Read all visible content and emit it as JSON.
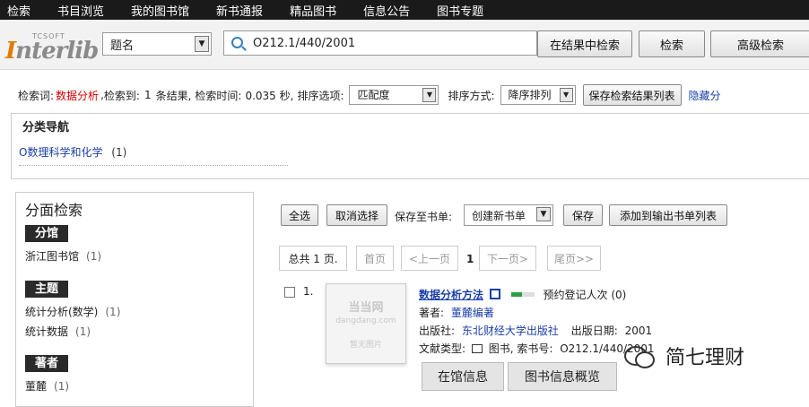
{
  "topnav": [
    "检索",
    "书目浏览",
    "我的图书馆",
    "新书通报",
    "精品图书",
    "信息公告",
    "图书专题"
  ],
  "logo": {
    "tcsoft": "TCSOFT",
    "interlib_i": "I",
    "interlib_rest": "nterlib"
  },
  "search": {
    "field": "题名",
    "query": "O212.1/440/2001",
    "btn_within": "在结果中检索",
    "btn_search": "检索",
    "btn_advanced": "高级检索"
  },
  "info": {
    "label_query": "检索词:",
    "query": "数据分析",
    "label_found": "检索到:",
    "count": "1",
    "label_results": "条结果,",
    "label_time": "检索时间:",
    "time": "0.035 秒,",
    "label_sort": "排序选项:",
    "sort_option": "匹配度",
    "label_order": "排序方式:",
    "sort_order": "降序排列",
    "btn_save": "保存检索结果列表",
    "link_hide": "隐藏分"
  },
  "category": {
    "title": "分类导航",
    "link": "O数理科学和化学",
    "count": "(1)"
  },
  "facets": {
    "title": "分面检索",
    "groups": [
      {
        "head": "分馆",
        "items": [
          {
            "label": "浙江图书馆",
            "count": "(1)"
          }
        ]
      },
      {
        "head": "主题",
        "items": [
          {
            "label": "统计分析(数学)",
            "count": "(1)"
          },
          {
            "label": "统计数据",
            "count": "(1)"
          }
        ]
      },
      {
        "head": "著者",
        "items": [
          {
            "label": "董麓",
            "count": "(1)"
          }
        ]
      }
    ]
  },
  "toolbar": {
    "select_all": "全选",
    "cancel": "取消选择",
    "save_to_label": "保存至书单:",
    "booklist": "创建新书单",
    "save": "保存",
    "add_to_output": "添加到输出书单列表"
  },
  "pager": {
    "total": "总共 1 页.",
    "first": "首页",
    "prev": "<上一页",
    "current": "1",
    "next": "下一页>",
    "last": "尾页>>"
  },
  "result": {
    "index": "1.",
    "title": "数据分析方法",
    "reserve_text": "预约登记人次 (0)",
    "author_label": "著者:",
    "author": "董麓编著",
    "publisher_label": "出版社:",
    "publisher": "东北财经大学出版社",
    "date_label": "出版日期:",
    "date": "2001",
    "type_label": "文献类型:",
    "type": "图书, 索书号:",
    "callno": "O212.1/440/2001",
    "thumb_line1": "当当网",
    "thumb_line2": "dangdang.com",
    "thumb_line3": "暂无图片",
    "tab_holdings": "在馆信息",
    "tab_overview": "图书信息概览"
  },
  "watermark": "简七理财",
  "colors": {
    "accent_red": "#d40000",
    "link_blue": "#1a3fa8",
    "nav_bg": "#1a1a1a",
    "reserve_green": "#2e9e44"
  }
}
